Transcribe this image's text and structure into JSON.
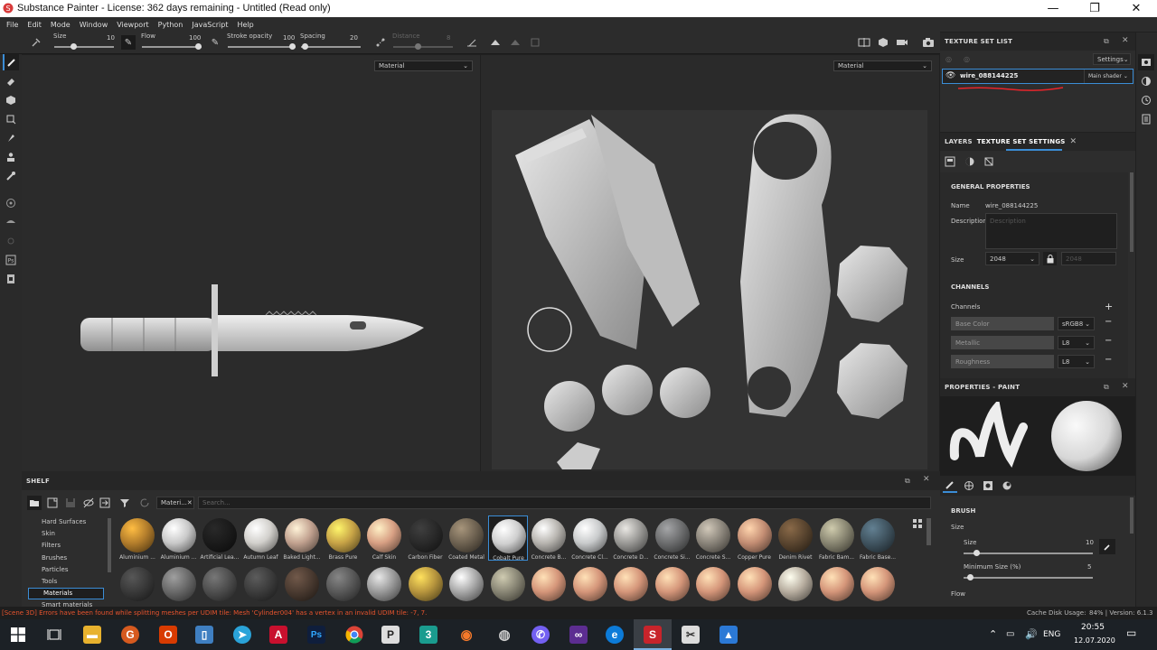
{
  "window": {
    "title": "Substance Painter - License: 362 days remaining - Untitled (Read only)",
    "minimize": "—",
    "maximize": "❐",
    "close": "✕"
  },
  "menu": [
    "File",
    "Edit",
    "Mode",
    "Window",
    "Viewport",
    "Python",
    "JavaScript",
    "Help"
  ],
  "toolbar": {
    "size_label": "Size",
    "size_value": "10",
    "flow_label": "Flow",
    "flow_value": "100",
    "stroke_opacity_label": "Stroke opacity",
    "stroke_opacity_value": "100",
    "spacing_label": "Spacing",
    "spacing_value": "20",
    "distance_label": "Distance",
    "distance_value": "8"
  },
  "viewport": {
    "left_mode": "Material",
    "right_mode": "Material"
  },
  "texture_set_list": {
    "title": "TEXTURE SET LIST",
    "settings_label": "Settings",
    "item_name": "wire_088144225",
    "shader": "Main shader"
  },
  "tabs": {
    "layers": "LAYERS",
    "texture_set_settings": "TEXTURE SET SETTINGS"
  },
  "general": {
    "heading": "GENERAL PROPERTIES",
    "name_label": "Name",
    "name_value": "wire_088144225",
    "description_label": "Description",
    "description_placeholder": "Description",
    "size_label": "Size",
    "size_value": "2048",
    "size_locked_value": "2048"
  },
  "channels": {
    "heading": "CHANNELS",
    "label": "Channels",
    "rows": [
      {
        "name": "Base Color",
        "format": "sRGB8"
      },
      {
        "name": "Metallic",
        "format": "L8"
      },
      {
        "name": "Roughness",
        "format": "L8"
      }
    ]
  },
  "properties": {
    "title": "PROPERTIES - PAINT",
    "brush_heading": "BRUSH",
    "size_section": "Size",
    "size_label": "Size",
    "size_value": "10",
    "size_fraction": 0.1,
    "min_size_label": "Minimum Size (%)",
    "min_size_value": "5",
    "min_size_fraction": 0.05,
    "flow_label": "Flow"
  },
  "shelf": {
    "title": "SHELF",
    "filter_tag": "Materi...",
    "search_placeholder": "Search...",
    "categories": [
      "Hard Surfaces",
      "Skin",
      "Filters",
      "Brushes",
      "Particles",
      "Tools",
      "Materials",
      "Smart materials"
    ],
    "selected_category": "Materials",
    "materials_row1": [
      {
        "name": "Aluminium ...",
        "color": "#b47e2c"
      },
      {
        "name": "Aluminium ...",
        "color": "#c9c9c9"
      },
      {
        "name": "Artificial Lea...",
        "color": "#1b1b1b"
      },
      {
        "name": "Autumn Leaf",
        "color": "#d2d0cc"
      },
      {
        "name": "Baked Light...",
        "color": "#c2a290"
      },
      {
        "name": "Brass Pure",
        "color": "#c8a447"
      },
      {
        "name": "Calf Skin",
        "color": "#d8a084"
      },
      {
        "name": "Carbon Fiber",
        "color": "#2a2a2a"
      },
      {
        "name": "Coated Metal",
        "color": "#6f6352"
      },
      {
        "name": "Cobalt Pure",
        "color": "#cfcfcf"
      },
      {
        "name": "Concrete B...",
        "color": "#b8b5b0"
      },
      {
        "name": "Concrete Cl...",
        "color": "#c9cbcc"
      },
      {
        "name": "Concrete D...",
        "color": "#9b9a97"
      },
      {
        "name": "Concrete Si...",
        "color": "#6d6e6f"
      },
      {
        "name": "Concrete S...",
        "color": "#8b857b"
      },
      {
        "name": "Copper Pure",
        "color": "#c48e74"
      },
      {
        "name": "Denim Rivet",
        "color": "#5b4630"
      },
      {
        "name": "Fabric Bam...",
        "color": "#8a8773"
      },
      {
        "name": "Fabric Base...",
        "color": "#415561"
      }
    ],
    "materials_row2": [
      {
        "color": "#3a3a3a"
      },
      {
        "color": "#6a6a6a"
      },
      {
        "color": "#4f4f4f"
      },
      {
        "color": "#3d3d3d"
      },
      {
        "color": "#4b3b31"
      },
      {
        "color": "#595959"
      },
      {
        "color": "#9a9a9a"
      },
      {
        "color": "#b8963e"
      },
      {
        "color": "#a9a9a9"
      },
      {
        "color": "#8a8776"
      },
      {
        "color": "#d5967a"
      },
      {
        "color": "#d5967a"
      },
      {
        "color": "#d5967a"
      },
      {
        "color": "#d5967a"
      },
      {
        "color": "#d5967a"
      },
      {
        "color": "#d5967a"
      },
      {
        "color": "#b8aea0"
      },
      {
        "color": "#d5967a"
      },
      {
        "color": "#d5967a"
      }
    ]
  },
  "status": {
    "message": "[Scene 3D] Errors have been found while splitting meshes per UDIM tile: Mesh 'Cylinder004' has a vertex in an invalid UDIM tile: -7, 7.",
    "cache": "Cache Disk Usage:",
    "cache_value": "84% | Version: 6.1.3"
  },
  "taskbar": {
    "language": "ENG",
    "time": "20:55",
    "date": "12.07.2020"
  },
  "colors": {
    "accent": "#3b8dd6",
    "annotation": "#e8252b",
    "panel": "#2d2d2d"
  }
}
